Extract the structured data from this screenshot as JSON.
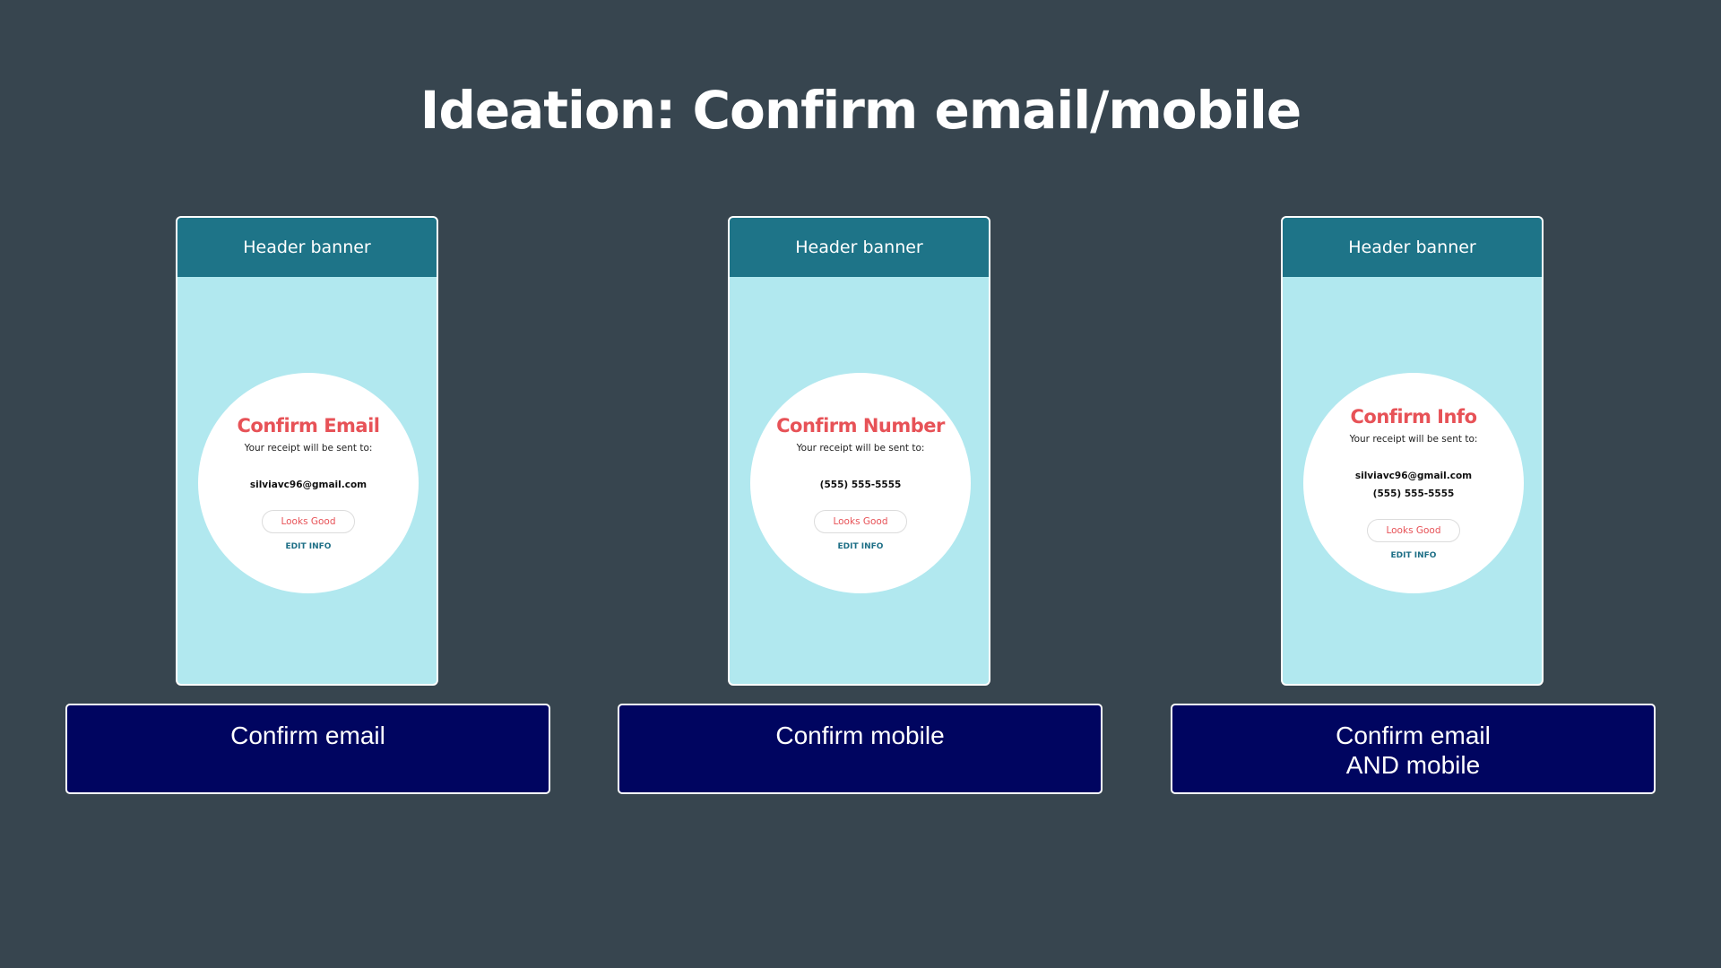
{
  "slide": {
    "title": "Ideation: Confirm email/mobile"
  },
  "colors": {
    "background": "#37454f",
    "phone_body": "#b1e8ef",
    "header_banner": "#1e7488",
    "confirm_title": "#e75257",
    "edit_info": "#1e6f86",
    "caption_box": "#000560"
  },
  "mockups": [
    {
      "header": "Header banner",
      "title": "Confirm Email",
      "subtitle": "Your receipt will be sent to:",
      "email": "silviavc96@gmail.com",
      "button": "Looks Good",
      "link": "EDIT INFO"
    },
    {
      "header": "Header banner",
      "title": "Confirm Number",
      "subtitle": "Your receipt will be sent to:",
      "phone": "(555) 555-5555",
      "button": "Looks Good",
      "link": "EDIT INFO"
    },
    {
      "header": "Header banner",
      "title": "Confirm Info",
      "subtitle": "Your receipt will be sent to:",
      "email": "silviavc96@gmail.com",
      "phone": "(555) 555-5555",
      "button": "Looks Good",
      "link": "EDIT INFO"
    }
  ],
  "captions": [
    {
      "line1": "Confirm email"
    },
    {
      "line1": "Confirm mobile"
    },
    {
      "line1": "Confirm email",
      "line2": "AND mobile"
    }
  ]
}
